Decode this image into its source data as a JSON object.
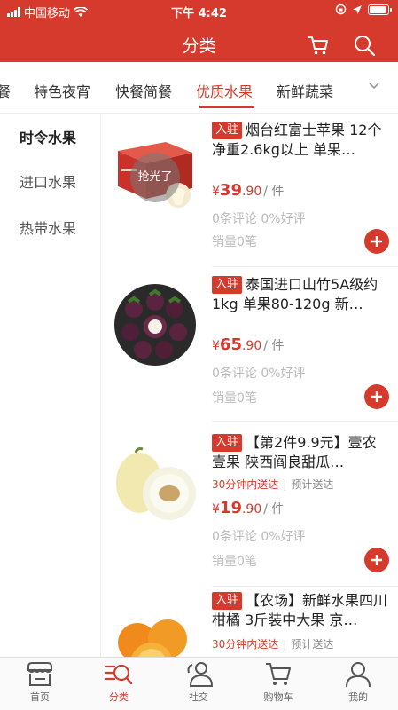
{
  "status_bar": {
    "carrier": "中国移动",
    "time": "下午 4:42"
  },
  "header": {
    "title": "分类",
    "cart_icon": "cart-icon",
    "search_icon": "search-icon"
  },
  "category_tabs": [
    {
      "label": "餐"
    },
    {
      "label": "特色夜宵"
    },
    {
      "label": "快餐简餐"
    },
    {
      "label": "优质水果",
      "active": true
    },
    {
      "label": "新鲜蔬菜"
    }
  ],
  "sidebar": {
    "items": [
      {
        "label": "时令水果",
        "active": true
      },
      {
        "label": "进口水果"
      },
      {
        "label": "热带水果"
      }
    ]
  },
  "products": [
    {
      "badge": "入驻",
      "name": "烟台红富士苹果 12个 净重2.6kg以上 单果…",
      "price_symbol": "¥",
      "price_int": "39",
      "price_dec": ".90",
      "unit": "/ 件",
      "reviews": "0条评论 0%好评",
      "sales": "销量0笔",
      "soldout": "抢光了"
    },
    {
      "badge": "入驻",
      "name": "泰国进口山竹5A级约1kg 单果80-120g 新…",
      "price_symbol": "¥",
      "price_int": "65",
      "price_dec": ".90",
      "unit": "/ 件",
      "reviews": "0条评论 0%好评",
      "sales": "销量0笔"
    },
    {
      "badge": "入驻",
      "name": "【第2件9.9元】壹农壹果 陕西阎良甜瓜…",
      "delivery": "30分钟内送达",
      "delivery_est": "预计送达",
      "price_symbol": "¥",
      "price_int": "19",
      "price_dec": ".90",
      "unit": "/ 件",
      "reviews": "0条评论 0%好评",
      "sales": "销量0笔"
    },
    {
      "badge": "入驻",
      "name": "【农场】新鲜水果四川柑橘 3斤装中大果 京…",
      "delivery": "30分钟内送达",
      "delivery_est": "预计送达"
    }
  ],
  "bottom_nav": [
    {
      "label": "首页",
      "icon": "home-icon"
    },
    {
      "label": "分类",
      "icon": "category-icon",
      "active": true
    },
    {
      "label": "社交",
      "icon": "social-icon"
    },
    {
      "label": "购物车",
      "icon": "cart-icon"
    },
    {
      "label": "我的",
      "icon": "profile-icon"
    }
  ],
  "colors": {
    "brand": "#d53a2c",
    "muted": "#bbbbbb"
  }
}
